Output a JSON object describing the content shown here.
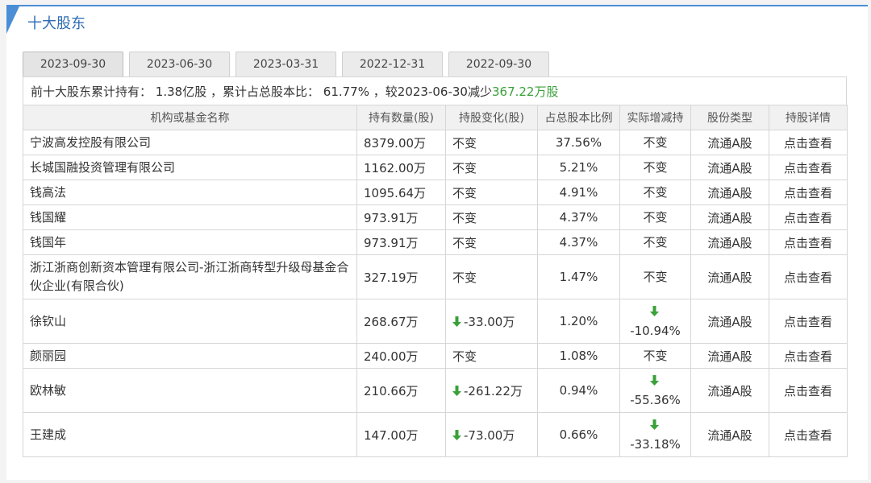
{
  "section": {
    "title": "十大股东"
  },
  "tabs": [
    {
      "label": "2023-09-30",
      "active": true
    },
    {
      "label": "2023-06-30",
      "active": false
    },
    {
      "label": "2023-03-31",
      "active": false
    },
    {
      "label": "2022-12-31",
      "active": false
    },
    {
      "label": "2022-09-30",
      "active": false
    }
  ],
  "summary": {
    "prefix": "前十大股东累计持有：",
    "total": "1.38亿股",
    "ratio_label": "，累计占总股本比：",
    "ratio": "61.77%",
    "compare_label": "，较",
    "compare_date": "2023-06-30",
    "direction": "减少",
    "change": "367.22万股"
  },
  "table": {
    "headers": [
      "机构或基金名称",
      "持有数量(股)",
      "持股变化(股)",
      "占总股本比例",
      "实际增减持",
      "股份类型",
      "持股详情"
    ],
    "rows": [
      {
        "name": "宁波高发控股有限公司",
        "amount": "8379.00万",
        "change": "不变",
        "change_dir": "none",
        "pct": "37.56%",
        "real": "不变",
        "real_dir": "none",
        "type": "流通A股",
        "link": "点击查看"
      },
      {
        "name": "长城国融投资管理有限公司",
        "amount": "1162.00万",
        "change": "不变",
        "change_dir": "none",
        "pct": "5.21%",
        "real": "不变",
        "real_dir": "none",
        "type": "流通A股",
        "link": "点击查看"
      },
      {
        "name": "钱高法",
        "amount": "1095.64万",
        "change": "不变",
        "change_dir": "none",
        "pct": "4.91%",
        "real": "不变",
        "real_dir": "none",
        "type": "流通A股",
        "link": "点击查看"
      },
      {
        "name": "钱国耀",
        "amount": "973.91万",
        "change": "不变",
        "change_dir": "none",
        "pct": "4.37%",
        "real": "不变",
        "real_dir": "none",
        "type": "流通A股",
        "link": "点击查看"
      },
      {
        "name": "钱国年",
        "amount": "973.91万",
        "change": "不变",
        "change_dir": "none",
        "pct": "4.37%",
        "real": "不变",
        "real_dir": "none",
        "type": "流通A股",
        "link": "点击查看"
      },
      {
        "name": "浙江浙商创新资本管理有限公司-浙江浙商转型升级母基金合伙企业(有限合伙)",
        "amount": "327.19万",
        "change": "不变",
        "change_dir": "none",
        "pct": "1.47%",
        "real": "不变",
        "real_dir": "none",
        "type": "流通A股",
        "link": "点击查看"
      },
      {
        "name": "徐钦山",
        "amount": "268.67万",
        "change": "-33.00万",
        "change_dir": "down",
        "pct": "1.20%",
        "real": "-10.94%",
        "real_dir": "down",
        "type": "流通A股",
        "link": "点击查看"
      },
      {
        "name": "颜丽园",
        "amount": "240.00万",
        "change": "不变",
        "change_dir": "none",
        "pct": "1.08%",
        "real": "不变",
        "real_dir": "none",
        "type": "流通A股",
        "link": "点击查看"
      },
      {
        "name": "欧林敏",
        "amount": "210.66万",
        "change": "-261.22万",
        "change_dir": "down",
        "pct": "0.94%",
        "real": "-55.36%",
        "real_dir": "down",
        "type": "流通A股",
        "link": "点击查看"
      },
      {
        "name": "王建成",
        "amount": "147.00万",
        "change": "-73.00万",
        "change_dir": "down",
        "pct": "0.66%",
        "real": "-33.18%",
        "real_dir": "down",
        "type": "流通A股",
        "link": "点击查看"
      }
    ]
  },
  "colors": {
    "accent": "#4a8fd6",
    "link": "#2f6cb5",
    "decrease": "#3aa13a",
    "header_bg": "#f1f1f1",
    "border": "#d6d6d6"
  },
  "icons": {
    "decrease": "arrow-down-icon"
  }
}
